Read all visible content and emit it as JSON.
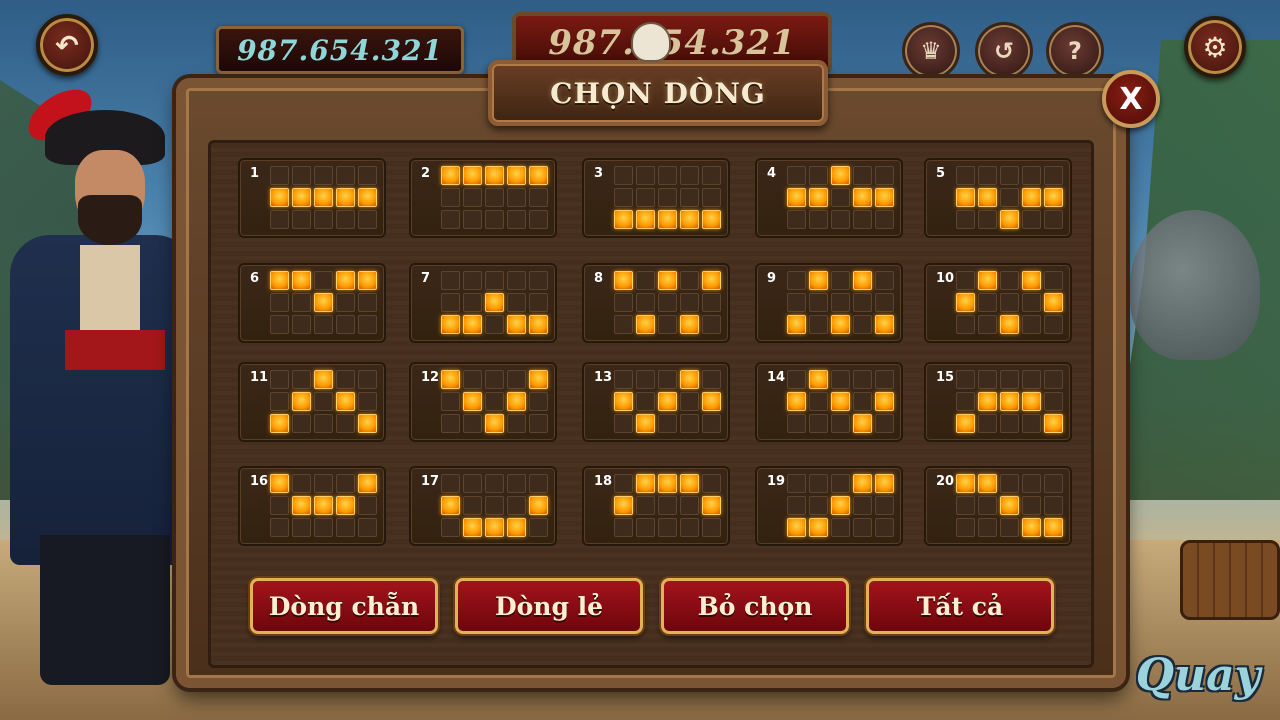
{
  "hud": {
    "balance": "987.654.321",
    "jackpot": "987.654.321",
    "back_icon": "back-arrow-icon",
    "settings_icon": "gear-icon",
    "crown_icon": "crown-icon",
    "history_icon": "history-icon",
    "help_icon": "help-icon"
  },
  "panel": {
    "title": "CHỌN DÒNG",
    "close_label": "X"
  },
  "lines": [
    {
      "num": "1",
      "rows": [
        "00000",
        "11111",
        "00000"
      ]
    },
    {
      "num": "2",
      "rows": [
        "11111",
        "00000",
        "00000"
      ]
    },
    {
      "num": "3",
      "rows": [
        "00000",
        "00000",
        "11111"
      ]
    },
    {
      "num": "4",
      "rows": [
        "00100",
        "11011",
        "00000"
      ]
    },
    {
      "num": "5",
      "rows": [
        "00000",
        "11011",
        "00100"
      ]
    },
    {
      "num": "6",
      "rows": [
        "11011",
        "00100",
        "00000"
      ]
    },
    {
      "num": "7",
      "rows": [
        "00000",
        "00100",
        "11011"
      ]
    },
    {
      "num": "8",
      "rows": [
        "10101",
        "00000",
        "01010"
      ]
    },
    {
      "num": "9",
      "rows": [
        "01010",
        "00000",
        "10101"
      ]
    },
    {
      "num": "10",
      "rows": [
        "01010",
        "10001",
        "00100"
      ]
    },
    {
      "num": "11",
      "rows": [
        "00100",
        "01010",
        "10001"
      ]
    },
    {
      "num": "12",
      "rows": [
        "10001",
        "01010",
        "00100"
      ]
    },
    {
      "num": "13",
      "rows": [
        "00010",
        "10101",
        "01000"
      ]
    },
    {
      "num": "14",
      "rows": [
        "01000",
        "10101",
        "00010"
      ]
    },
    {
      "num": "15",
      "rows": [
        "00000",
        "01110",
        "10001"
      ]
    },
    {
      "num": "16",
      "rows": [
        "10001",
        "01110",
        "00000"
      ]
    },
    {
      "num": "17",
      "rows": [
        "00000",
        "10001",
        "01110"
      ]
    },
    {
      "num": "18",
      "rows": [
        "01110",
        "10001",
        "00000"
      ]
    },
    {
      "num": "19",
      "rows": [
        "00011",
        "00100",
        "11000"
      ]
    },
    {
      "num": "20",
      "rows": [
        "11000",
        "00100",
        "00011"
      ]
    }
  ],
  "buttons": {
    "even": "Dòng chẵn",
    "odd": "Dòng lẻ",
    "deselect": "Bỏ chọn",
    "all": "Tất cả"
  },
  "spin_label": "Quay",
  "colors": {
    "selected_cell": "#ff9a00",
    "button_red": "#a4131b",
    "button_border": "#e2b25a"
  }
}
